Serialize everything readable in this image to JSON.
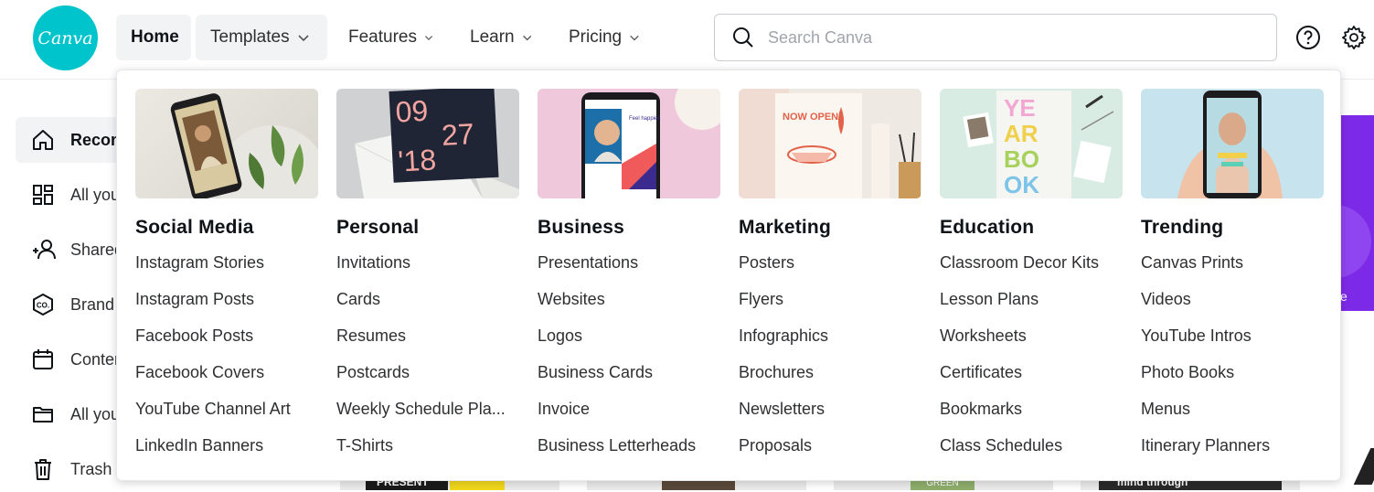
{
  "logo": {
    "text": "Canva"
  },
  "nav": {
    "home": "Home",
    "templates": "Templates",
    "features": "Features",
    "learn": "Learn",
    "pricing": "Pricing"
  },
  "search": {
    "placeholder": "Search Canva",
    "value": ""
  },
  "sidebar": {
    "items": [
      {
        "label": "Recon",
        "icon": "home-icon"
      },
      {
        "label": "All you",
        "icon": "grid-icon"
      },
      {
        "label": "Shared",
        "icon": "people-icon"
      },
      {
        "label": "Brand",
        "icon": "brand-kit-icon"
      },
      {
        "label": "Conter",
        "icon": "calendar-icon"
      },
      {
        "label": "All you",
        "icon": "folder-icon"
      },
      {
        "label": "Trash",
        "icon": "trash-icon"
      }
    ]
  },
  "background": {
    "banner_text": "e",
    "card_present": "PRESENT",
    "card_green": "GREEN",
    "card_mind": "mind through"
  },
  "menu": {
    "columns": [
      {
        "title": "Social Media",
        "items": [
          "Instagram Stories",
          "Instagram Posts",
          "Facebook Posts",
          "Facebook Covers",
          "YouTube Channel Art",
          "LinkedIn Banners"
        ]
      },
      {
        "title": "Personal",
        "items": [
          "Invitations",
          "Cards",
          "Resumes",
          "Postcards",
          "Weekly Schedule Pla...",
          "T-Shirts"
        ]
      },
      {
        "title": "Business",
        "items": [
          "Presentations",
          "Websites",
          "Logos",
          "Business Cards",
          "Invoice",
          "Business Letterheads"
        ]
      },
      {
        "title": "Marketing",
        "items": [
          "Posters",
          "Flyers",
          "Infographics",
          "Brochures",
          "Newsletters",
          "Proposals"
        ]
      },
      {
        "title": "Education",
        "items": [
          "Classroom Decor Kits",
          "Lesson Plans",
          "Worksheets",
          "Certificates",
          "Bookmarks",
          "Class Schedules"
        ]
      },
      {
        "title": "Trending",
        "items": [
          "Canvas Prints",
          "Videos",
          "YouTube Intros",
          "Photo Books",
          "Menus",
          "Itinerary Planners"
        ]
      }
    ],
    "thumb_text": {
      "personal_date": [
        "09",
        "27",
        "'18"
      ],
      "business_phone": "Feel happier.",
      "marketing_poster": "NOW OPEN!",
      "education_book": [
        "YE",
        "AR",
        "BO",
        "OK"
      ]
    }
  },
  "colors": {
    "brand": "#00c4cc",
    "purple": "#7d2ae8"
  }
}
